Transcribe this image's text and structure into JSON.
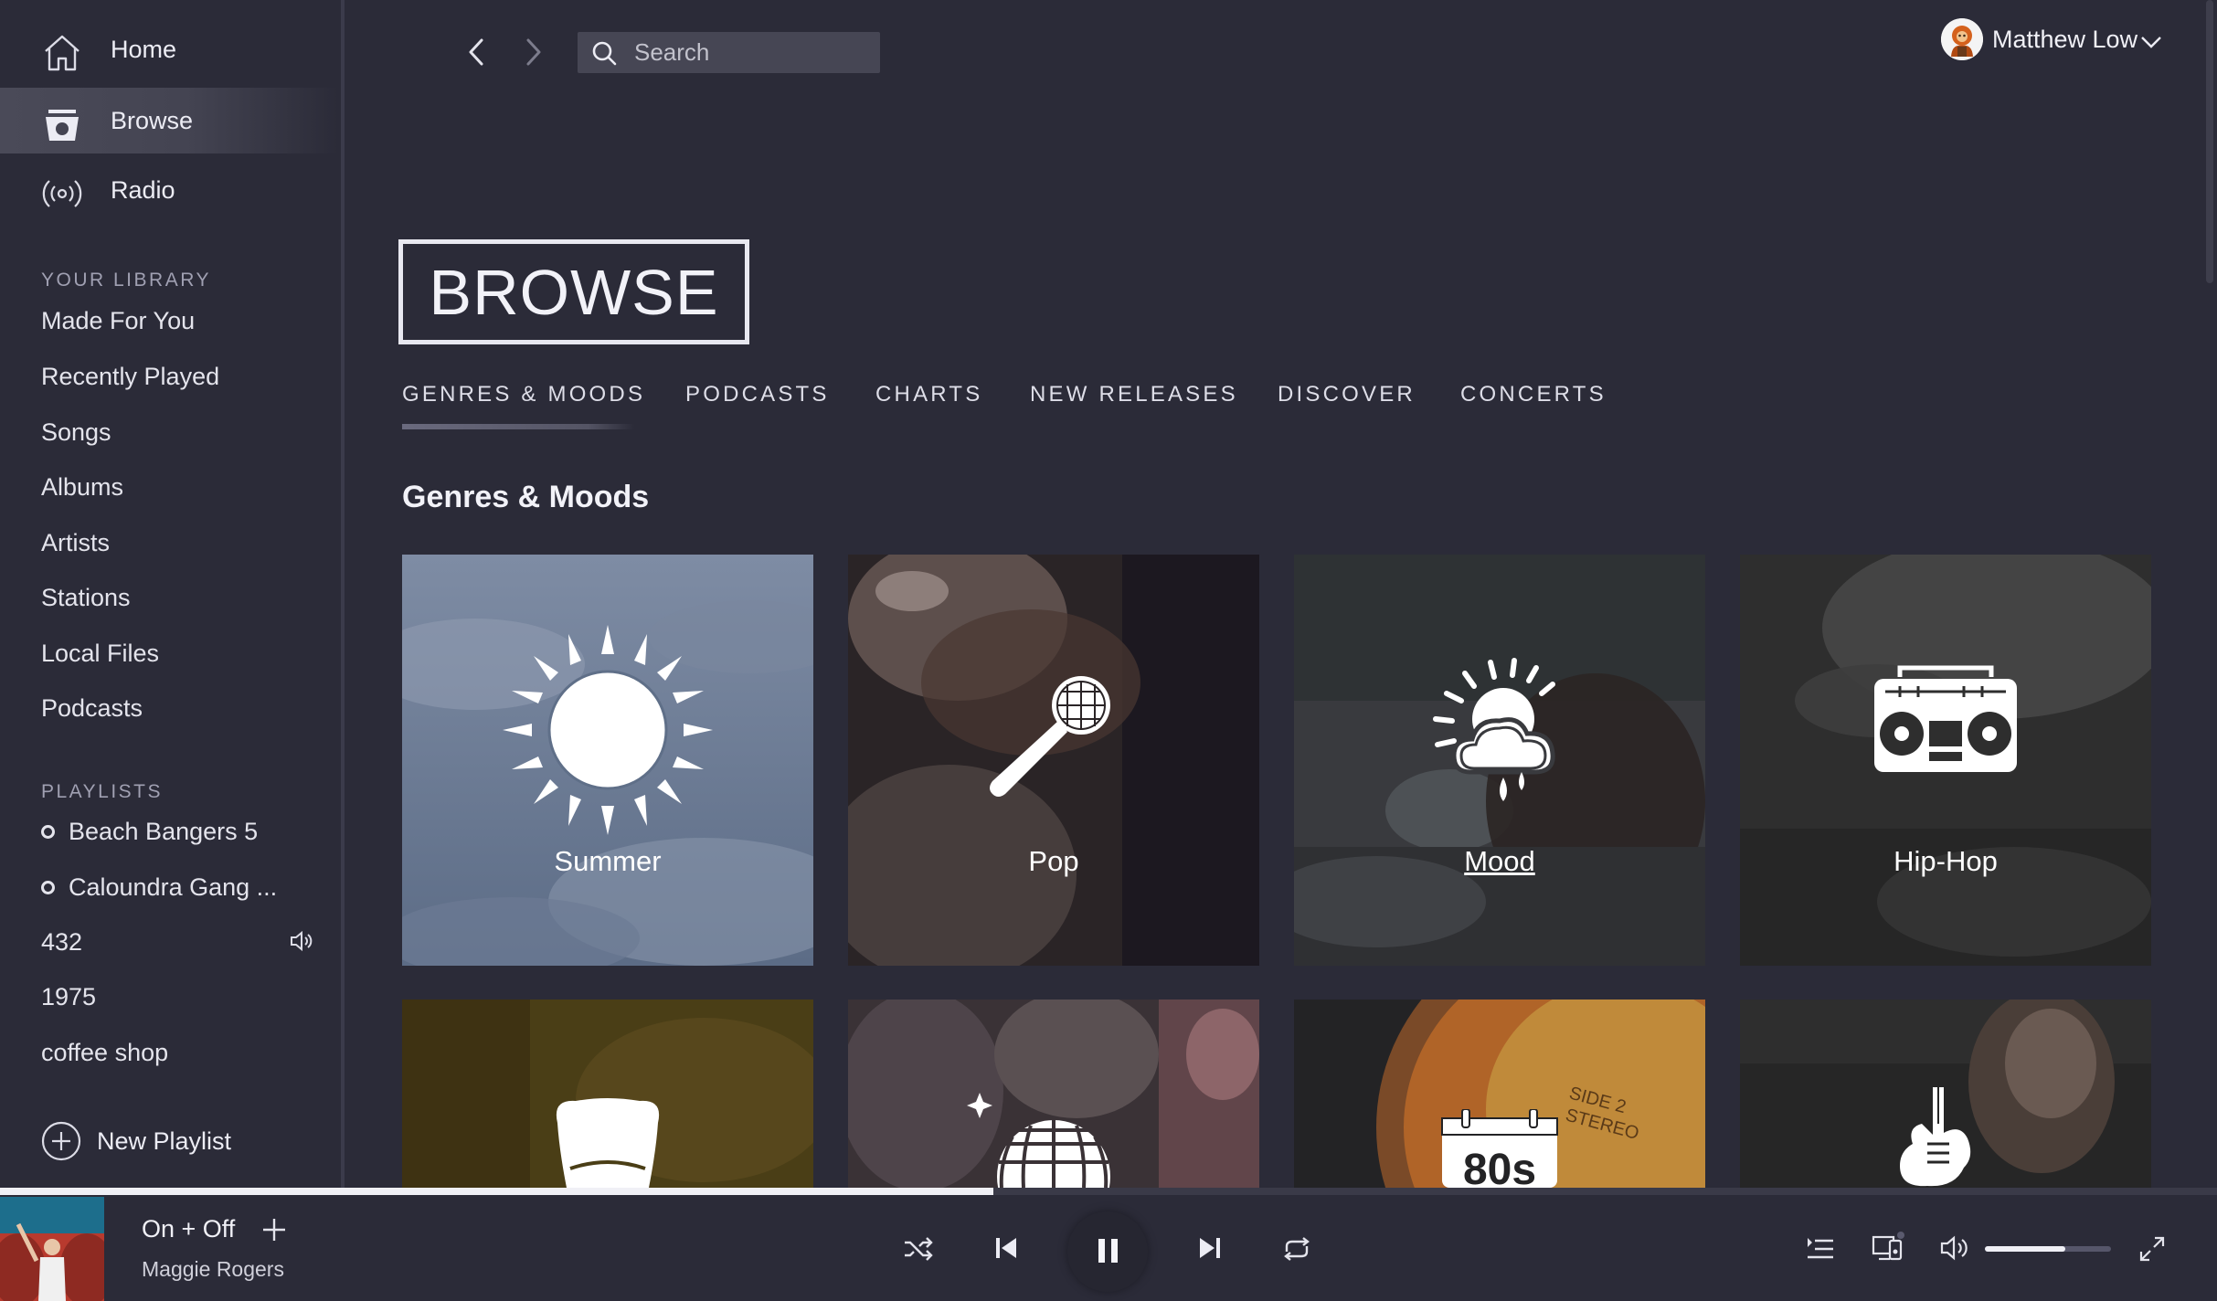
{
  "nav": {
    "home": "Home",
    "browse": "Browse",
    "radio": "Radio"
  },
  "library": {
    "title": "YOUR LIBRARY",
    "items": [
      "Made For You",
      "Recently Played",
      "Songs",
      "Albums",
      "Artists",
      "Stations",
      "Local Files",
      "Podcasts"
    ]
  },
  "playlists": {
    "title": "PLAYLISTS",
    "items": [
      "Beach Bangers 5",
      "Caloundra Gang ...",
      "432",
      "1975",
      "coffee shop"
    ],
    "new_playlist": "New Playlist"
  },
  "search": {
    "placeholder": "Search"
  },
  "user": {
    "name": "Matthew Low"
  },
  "page": {
    "title": "BROWSE",
    "tabs": [
      "GENRES & MOODS",
      "PODCASTS",
      "CHARTS",
      "NEW RELEASES",
      "DISCOVER",
      "CONCERTS"
    ],
    "active_tab": "GENRES & MOODS",
    "section_heading": "Genres & Moods",
    "tiles": [
      {
        "label": "Summer",
        "icon": "sun-icon"
      },
      {
        "label": "Pop",
        "icon": "microphone-icon"
      },
      {
        "label": "Mood",
        "icon": "weather-icon"
      },
      {
        "label": "Hip-Hop",
        "icon": "boombox-icon"
      }
    ],
    "tiles_row2_icons": [
      "armchair-icon",
      "disco-ball-icon",
      "calendar-80s-icon",
      "electric-guitar-icon"
    ],
    "tile_row2_text": "80s"
  },
  "player": {
    "track": "On + Off",
    "artist": "Maggie Rogers",
    "progress": 0.448,
    "volume": 0.64,
    "state": "playing"
  },
  "colors": {
    "background": "#2b2b38",
    "sidebar_active": "#4a4a58",
    "search_bg": "#464654",
    "text": "#ececf4"
  }
}
